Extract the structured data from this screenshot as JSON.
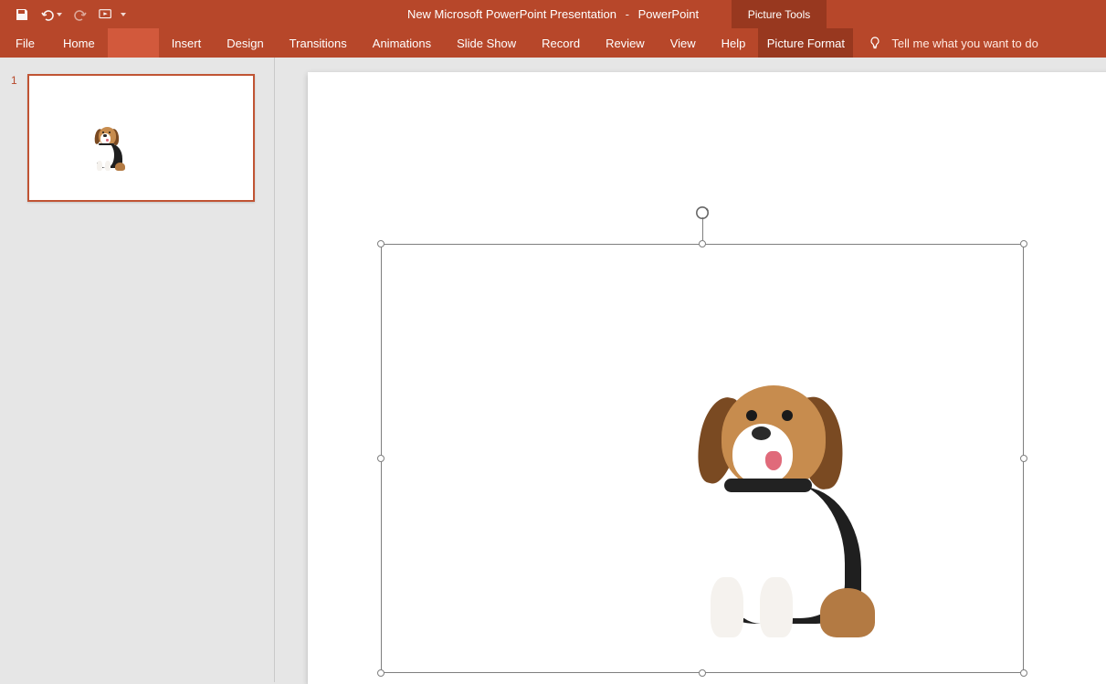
{
  "title": {
    "document": "New Microsoft PowerPoint Presentation",
    "separator": "-",
    "app": "PowerPoint",
    "context_tool": "Picture Tools"
  },
  "tabs": {
    "file": "File",
    "home": "Home",
    "hidden": "",
    "insert": "Insert",
    "design": "Design",
    "transitions": "Transitions",
    "animations": "Animations",
    "slideshow": "Slide Show",
    "record": "Record",
    "review": "Review",
    "view": "View",
    "help": "Help",
    "picture_format": "Picture Format",
    "tellme": "Tell me what you want to do"
  },
  "slides": {
    "first_number": "1"
  },
  "qat": {
    "save": "save-icon",
    "undo": "undo-icon",
    "redo": "redo-icon",
    "start": "start-from-beginning-icon",
    "customize": "customize-qat-icon"
  }
}
